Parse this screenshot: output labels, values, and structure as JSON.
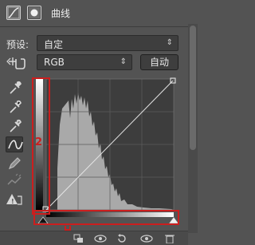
{
  "header": {
    "title": "曲线"
  },
  "preset": {
    "label": "预设:",
    "value": "自定"
  },
  "channel": {
    "value": "RGB"
  },
  "auto_button": {
    "label": "自动"
  },
  "annotation": {
    "number": "2"
  },
  "icons": {
    "adjustment-icon": "curves-adjustment-icon",
    "mask-icon": "layer-mask-icon",
    "hand-icon": "on-image-adjust-icon",
    "eyedroppers": [
      "eyedropper-icon",
      "black-point-eyedropper-icon",
      "gray-point-eyedropper-icon",
      "white-point-eyedropper-icon"
    ],
    "curve-tool": "curve-edit-icon",
    "pencil-tool": "pencil-icon",
    "smooth-tool": "smooth-icon",
    "clipping-warning": "clipping-warning-icon",
    "bottom": [
      "clip-to-layer-icon",
      "view-previous-icon",
      "reset-icon",
      "visibility-icon",
      "trash-icon"
    ]
  },
  "colors": {
    "panel": "#535353",
    "accent_red": "#cc1e1e"
  }
}
